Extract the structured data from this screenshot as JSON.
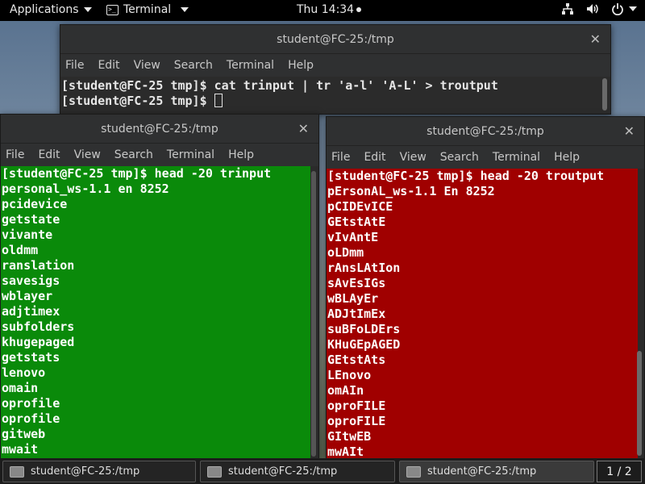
{
  "topbar": {
    "applications": "Applications",
    "terminal": "Terminal",
    "clock": "Thu 14:34"
  },
  "menu": [
    "File",
    "Edit",
    "View",
    "Search",
    "Terminal",
    "Help"
  ],
  "win_top": {
    "title": "student@FC-25:/tmp",
    "lines": [
      "[student@FC-25 tmp]$ cat trinput | tr 'a-l' 'A-L' > troutput",
      "[student@FC-25 tmp]$ "
    ]
  },
  "win_left": {
    "title": "student@FC-25:/tmp",
    "lines": [
      "[student@FC-25 tmp]$ head -20 trinput",
      "personal_ws-1.1 en 8252",
      "pcidevice",
      "getstate",
      "vivante",
      "oldmm",
      "ranslation",
      "savesigs",
      "wblayer",
      "adjtimex",
      "subfolders",
      "khugepaged",
      "getstats",
      "lenovo",
      "omain",
      "oprofile",
      "oprofile",
      "gitweb",
      "mwait"
    ]
  },
  "win_right": {
    "title": "student@FC-25:/tmp",
    "lines": [
      "[student@FC-25 tmp]$ head -20 troutput",
      "pErsonAL_ws-1.1 En 8252",
      "pCIDEvICE",
      "GEtstAtE",
      "vIvAntE",
      "oLDmm",
      "rAnsLAtIon",
      "sAvEsIGs",
      "wBLAyEr",
      "ADJtImEx",
      "suBFoLDErs",
      "KHuGEpAGED",
      "GEtstAts",
      "LEnovo",
      "omAIn",
      "oproFILE",
      "oproFILE",
      "GItwEB",
      "mwAIt"
    ]
  },
  "taskbar": {
    "tasks": [
      "student@FC-25:/tmp",
      "student@FC-25:/tmp",
      "student@FC-25:/tmp"
    ],
    "pager": "1 / 2"
  }
}
